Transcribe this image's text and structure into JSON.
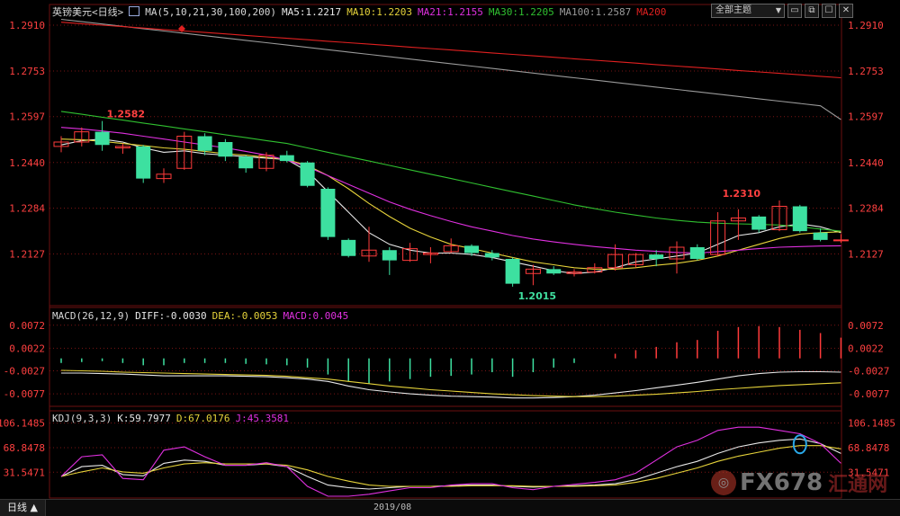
{
  "header": {
    "title": "英镑美元<日线>",
    "ma_params": "MA(5,10,21,30,100,200)",
    "ma5": "MA5:1.2217",
    "ma10": "MA10:1.2203",
    "ma21": "MA21:1.2155",
    "ma30": "MA30:1.2205",
    "ma100": "MA100:1.2587",
    "ma200": "MA200"
  },
  "toolbar": {
    "select_label": "全部主题",
    "caret": "▼"
  },
  "macd_header": {
    "title": "MACD(26,12,9)",
    "diff": "DIFF:-0.0030",
    "dea": "DEA:-0.0053",
    "macd": "MACD:0.0045"
  },
  "kdj_header": {
    "title": "KDJ(9,3,3)",
    "k": "K:59.7977",
    "d": "D:67.0176",
    "j": "J:45.3581"
  },
  "bottom_bar": {
    "period_tab": "日线 ▲",
    "date_label": "2019/08"
  },
  "watermark": {
    "mark": "◎",
    "text": "FX678",
    "cn": "汇通网"
  },
  "colors": {
    "up": "#ff3b3b",
    "down": "#3de0a0",
    "ma5": "#e8e8e8",
    "ma10": "#e6d33a",
    "ma21": "#e030e0",
    "ma30": "#30c030",
    "ma100": "#9a9a9a",
    "ma200": "#e02020",
    "axis": "#ff4040",
    "grid": "#7a1414"
  },
  "chart_data": [
    {
      "type": "candlestick",
      "title": "英镑美元<日线>",
      "y_ticks": [
        1.291,
        1.2753,
        1.2597,
        1.244,
        1.2284,
        1.2127
      ],
      "y_tick_labels": [
        "1.2910",
        "1.2753",
        "1.2597",
        "1.2440",
        "1.2284",
        "1.2127"
      ],
      "ylim": [
        1.195,
        1.295
      ],
      "annotations": [
        {
          "label": "1.2582",
          "index": 2,
          "value": 1.2582
        },
        {
          "label": "1.2310",
          "index": 32,
          "value": 1.231
        },
        {
          "label": "1.2015",
          "index": 22,
          "value": 1.2015
        }
      ],
      "candles": [
        {
          "o": 1.2495,
          "h": 1.253,
          "l": 1.2475,
          "c": 1.251
        },
        {
          "o": 1.251,
          "h": 1.256,
          "l": 1.2495,
          "c": 1.2545
        },
        {
          "o": 1.2545,
          "h": 1.2582,
          "l": 1.248,
          "c": 1.25
        },
        {
          "o": 1.249,
          "h": 1.2505,
          "l": 1.247,
          "c": 1.2495
        },
        {
          "o": 1.2495,
          "h": 1.25,
          "l": 1.237,
          "c": 1.2385
        },
        {
          "o": 1.2385,
          "h": 1.242,
          "l": 1.237,
          "c": 1.24
        },
        {
          "o": 1.242,
          "h": 1.2545,
          "l": 1.2415,
          "c": 1.253
        },
        {
          "o": 1.253,
          "h": 1.254,
          "l": 1.2465,
          "c": 1.248
        },
        {
          "o": 1.251,
          "h": 1.252,
          "l": 1.2445,
          "c": 1.246
        },
        {
          "o": 1.246,
          "h": 1.2465,
          "l": 1.2405,
          "c": 1.242
        },
        {
          "o": 1.242,
          "h": 1.2475,
          "l": 1.241,
          "c": 1.2465
        },
        {
          "o": 1.2465,
          "h": 1.248,
          "l": 1.244,
          "c": 1.2445
        },
        {
          "o": 1.244,
          "h": 1.2445,
          "l": 1.2355,
          "c": 1.236
        },
        {
          "o": 1.235,
          "h": 1.2355,
          "l": 1.2175,
          "c": 1.2185
        },
        {
          "o": 1.2175,
          "h": 1.218,
          "l": 1.2115,
          "c": 1.212
        },
        {
          "o": 1.212,
          "h": 1.222,
          "l": 1.21,
          "c": 1.214
        },
        {
          "o": 1.214,
          "h": 1.215,
          "l": 1.2055,
          "c": 1.2105
        },
        {
          "o": 1.2105,
          "h": 1.2165,
          "l": 1.21,
          "c": 1.2145
        },
        {
          "o": 1.2125,
          "h": 1.215,
          "l": 1.2095,
          "c": 1.213
        },
        {
          "o": 1.2135,
          "h": 1.218,
          "l": 1.213,
          "c": 1.2155
        },
        {
          "o": 1.2155,
          "h": 1.216,
          "l": 1.212,
          "c": 1.213
        },
        {
          "o": 1.213,
          "h": 1.214,
          "l": 1.2105,
          "c": 1.2115
        },
        {
          "o": 1.211,
          "h": 1.2115,
          "l": 1.2015,
          "c": 1.2025
        },
        {
          "o": 1.206,
          "h": 1.209,
          "l": 1.202,
          "c": 1.2075
        },
        {
          "o": 1.2075,
          "h": 1.2085,
          "l": 1.2055,
          "c": 1.206
        },
        {
          "o": 1.206,
          "h": 1.2075,
          "l": 1.205,
          "c": 1.2065
        },
        {
          "o": 1.2065,
          "h": 1.2095,
          "l": 1.206,
          "c": 1.208
        },
        {
          "o": 1.208,
          "h": 1.216,
          "l": 1.207,
          "c": 1.2125
        },
        {
          "o": 1.209,
          "h": 1.213,
          "l": 1.208,
          "c": 1.2125
        },
        {
          "o": 1.2125,
          "h": 1.214,
          "l": 1.2085,
          "c": 1.211
        },
        {
          "o": 1.211,
          "h": 1.217,
          "l": 1.206,
          "c": 1.215
        },
        {
          "o": 1.215,
          "h": 1.216,
          "l": 1.2105,
          "c": 1.211
        },
        {
          "o": 1.2125,
          "h": 1.227,
          "l": 1.212,
          "c": 1.224
        },
        {
          "o": 1.224,
          "h": 1.228,
          "l": 1.2175,
          "c": 1.225
        },
        {
          "o": 1.2255,
          "h": 1.226,
          "l": 1.22,
          "c": 1.221
        },
        {
          "o": 1.221,
          "h": 1.231,
          "l": 1.2205,
          "c": 1.229
        },
        {
          "o": 1.229,
          "h": 1.2295,
          "l": 1.22,
          "c": 1.2205
        },
        {
          "o": 1.22,
          "h": 1.2215,
          "l": 1.217,
          "c": 1.2175
        },
        {
          "o": 1.2175,
          "h": 1.2195,
          "l": 1.2165,
          "c": 1.2175
        }
      ],
      "ma_series": [
        {
          "name": "MA5",
          "color": "#e8e8e8",
          "values": [
            1.25,
            1.2515,
            1.252,
            1.251,
            1.249,
            1.2475,
            1.248,
            1.247,
            1.2465,
            1.246,
            1.2455,
            1.245,
            1.241,
            1.234,
            1.227,
            1.22,
            1.216,
            1.214,
            1.213,
            1.213,
            1.2125,
            1.2115,
            1.21,
            1.2085,
            1.207,
            1.206,
            1.2065,
            1.208,
            1.21,
            1.211,
            1.212,
            1.213,
            1.216,
            1.219,
            1.22,
            1.222,
            1.223,
            1.222,
            1.22
          ]
        },
        {
          "name": "MA10",
          "color": "#e6d33a",
          "values": [
            1.252,
            1.2518,
            1.2512,
            1.2505,
            1.2498,
            1.249,
            1.2485,
            1.2478,
            1.247,
            1.2465,
            1.2458,
            1.245,
            1.243,
            1.2395,
            1.235,
            1.23,
            1.2255,
            1.2215,
            1.2185,
            1.216,
            1.2145,
            1.213,
            1.2115,
            1.21,
            1.209,
            1.208,
            1.2075,
            1.2075,
            1.208,
            1.2088,
            1.2095,
            1.2105,
            1.212,
            1.214,
            1.216,
            1.218,
            1.2195,
            1.22,
            1.2203
          ]
        },
        {
          "name": "MA21",
          "color": "#e030e0",
          "values": [
            1.256,
            1.2555,
            1.2548,
            1.254,
            1.253,
            1.252,
            1.251,
            1.25,
            1.249,
            1.2478,
            1.2465,
            1.2448,
            1.2425,
            1.2395,
            1.2365,
            1.2335,
            1.2305,
            1.228,
            1.2258,
            1.2238,
            1.222,
            1.2205,
            1.219,
            1.2178,
            1.2168,
            1.216,
            1.2152,
            1.2146,
            1.214,
            1.2136,
            1.2132,
            1.213,
            1.2135,
            1.214,
            1.2145,
            1.215,
            1.2152,
            1.2154,
            1.2155
          ]
        },
        {
          "name": "MA30",
          "color": "#30c030",
          "values": [
            1.2615,
            1.2605,
            1.2595,
            1.2585,
            1.2575,
            1.2565,
            1.2555,
            1.2545,
            1.2535,
            1.2525,
            1.2515,
            1.2505,
            1.249,
            1.2475,
            1.246,
            1.2445,
            1.243,
            1.2415,
            1.24,
            1.2385,
            1.237,
            1.2355,
            1.234,
            1.2325,
            1.231,
            1.2295,
            1.2282,
            1.227,
            1.226,
            1.225,
            1.2242,
            1.2236,
            1.2232,
            1.223,
            1.2228,
            1.2226,
            1.222,
            1.2212,
            1.2205
          ]
        },
        {
          "name": "MA100",
          "color": "#9a9a9a",
          "values": [
            1.293,
            1.2922,
            1.2914,
            1.2906,
            1.2898,
            1.289,
            1.2882,
            1.2874,
            1.2866,
            1.2858,
            1.285,
            1.2842,
            1.2834,
            1.2826,
            1.2818,
            1.281,
            1.2802,
            1.2794,
            1.2786,
            1.2778,
            1.277,
            1.2762,
            1.2754,
            1.2746,
            1.2738,
            1.273,
            1.2722,
            1.2714,
            1.2706,
            1.2698,
            1.269,
            1.2682,
            1.2674,
            1.2666,
            1.2658,
            1.265,
            1.2642,
            1.2634,
            1.2587
          ]
        },
        {
          "name": "MA200",
          "color": "#e02020",
          "values": [
            1.292,
            1.2915,
            1.291,
            1.2905,
            1.29,
            1.2895,
            1.289,
            1.2885,
            1.288,
            1.2875,
            1.287,
            1.2865,
            1.286,
            1.2855,
            1.285,
            1.2845,
            1.284,
            1.2835,
            1.283,
            1.2825,
            1.282,
            1.2815,
            1.281,
            1.2805,
            1.28,
            1.2795,
            1.279,
            1.2785,
            1.278,
            1.2775,
            1.277,
            1.2765,
            1.276,
            1.2755,
            1.275,
            1.2745,
            1.274,
            1.2735,
            1.273
          ]
        }
      ]
    },
    {
      "type": "bar",
      "title": "MACD(26,12,9)",
      "y_ticks": [
        0.0072,
        0.0022,
        -0.0027,
        -0.0077
      ],
      "y_tick_labels": [
        "0.0072",
        "0.0022",
        "-0.0027",
        "-0.0077"
      ],
      "ylim": [
        -0.011,
        0.0095
      ],
      "histogram": [
        -0.001,
        -0.0008,
        -0.0006,
        -0.001,
        -0.0015,
        -0.0015,
        -0.001,
        -0.001,
        -0.001,
        -0.0012,
        -0.0013,
        -0.0015,
        -0.002,
        -0.0035,
        -0.005,
        -0.0055,
        -0.005,
        -0.0045,
        -0.004,
        -0.0038,
        -0.0035,
        -0.003,
        -0.004,
        -0.003,
        -0.002,
        -0.001,
        0.0,
        0.001,
        0.0018,
        0.0025,
        0.0035,
        0.004,
        0.006,
        0.0068,
        0.007,
        0.0068,
        0.0062,
        0.0055,
        0.0045
      ],
      "series": [
        {
          "name": "DIFF",
          "color": "#e8e8e8",
          "values": [
            -0.0032,
            -0.0032,
            -0.0033,
            -0.0034,
            -0.0036,
            -0.0038,
            -0.0038,
            -0.0038,
            -0.0038,
            -0.0039,
            -0.004,
            -0.0042,
            -0.0045,
            -0.005,
            -0.006,
            -0.0068,
            -0.0073,
            -0.0077,
            -0.008,
            -0.0082,
            -0.0083,
            -0.0084,
            -0.0086,
            -0.0086,
            -0.0085,
            -0.0083,
            -0.008,
            -0.0075,
            -0.007,
            -0.0064,
            -0.0058,
            -0.0052,
            -0.0045,
            -0.0038,
            -0.0033,
            -0.003,
            -0.0029,
            -0.0029,
            -0.003
          ]
        },
        {
          "name": "DEA",
          "color": "#e6d33a",
          "values": [
            -0.0026,
            -0.0027,
            -0.0028,
            -0.003,
            -0.0031,
            -0.0032,
            -0.0033,
            -0.0034,
            -0.0035,
            -0.0036,
            -0.0037,
            -0.0039,
            -0.0042,
            -0.0045,
            -0.005,
            -0.0055,
            -0.006,
            -0.0064,
            -0.0068,
            -0.0071,
            -0.0074,
            -0.0077,
            -0.0079,
            -0.0081,
            -0.0082,
            -0.0083,
            -0.0083,
            -0.0082,
            -0.008,
            -0.0078,
            -0.0075,
            -0.0072,
            -0.0068,
            -0.0065,
            -0.0062,
            -0.0059,
            -0.0057,
            -0.0055,
            -0.0053
          ]
        }
      ]
    },
    {
      "type": "line",
      "title": "KDJ(9,3,3)",
      "y_ticks": [
        106.1485,
        68.8478,
        31.5471
      ],
      "y_tick_labels": [
        "106.1485",
        "68.8478",
        "31.5471"
      ],
      "ylim": [
        -5,
        118
      ],
      "series": [
        {
          "name": "K",
          "color": "#e8e8e8",
          "values": [
            25,
            40,
            42,
            28,
            26,
            45,
            50,
            48,
            42,
            42,
            44,
            40,
            25,
            12,
            8,
            6,
            8,
            10,
            10,
            11,
            12,
            12,
            10,
            9,
            10,
            11,
            12,
            14,
            20,
            30,
            40,
            48,
            60,
            70,
            76,
            80,
            82,
            75,
            60
          ]
        },
        {
          "name": "D",
          "color": "#e6d33a",
          "values": [
            25,
            32,
            38,
            32,
            30,
            38,
            44,
            46,
            44,
            44,
            44,
            42,
            35,
            25,
            18,
            12,
            10,
            10,
            10,
            10,
            11,
            11,
            11,
            10,
            10,
            10,
            11,
            12,
            16,
            22,
            30,
            38,
            48,
            56,
            62,
            68,
            72,
            72,
            67
          ]
        },
        {
          "name": "J",
          "color": "#e030e0",
          "values": [
            25,
            55,
            58,
            22,
            20,
            65,
            70,
            55,
            42,
            42,
            46,
            40,
            10,
            -5,
            -5,
            -2,
            3,
            8,
            8,
            12,
            14,
            14,
            8,
            5,
            10,
            13,
            16,
            20,
            30,
            50,
            70,
            80,
            95,
            100,
            100,
            95,
            90,
            75,
            45
          ]
        }
      ]
    }
  ]
}
